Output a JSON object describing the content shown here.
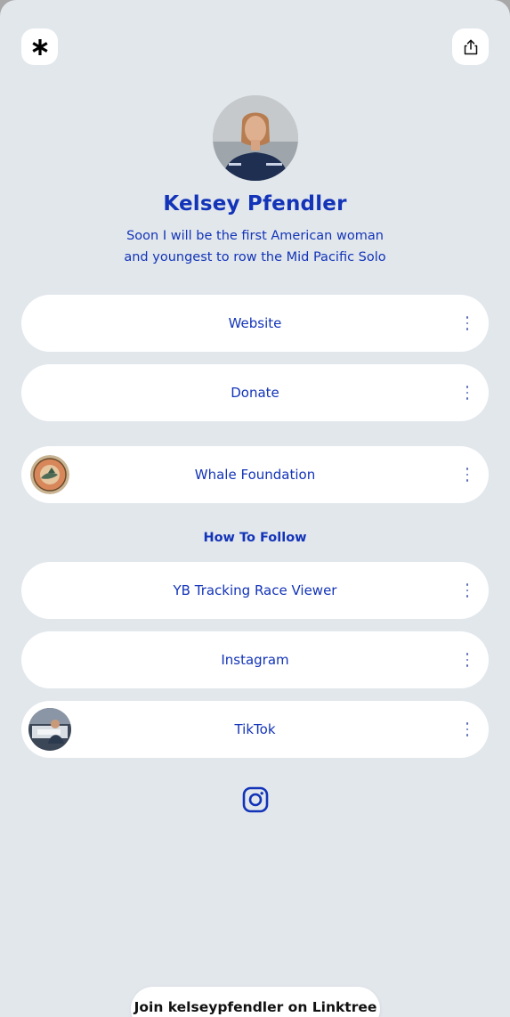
{
  "profile": {
    "name": "Kelsey Pfendler",
    "bio_line1": "Soon I will be the first American woman",
    "bio_line2": "and youngest to row the Mid Pacific Solo"
  },
  "links": [
    {
      "label": "Website"
    },
    {
      "label": "Donate"
    },
    {
      "label": "Whale Foundation",
      "thumbnail": "whale-foundation-logo"
    },
    {
      "label": "YB Tracking Race Viewer"
    },
    {
      "label": "Instagram"
    },
    {
      "label": "TikTok",
      "thumbnail": "tiktok-photo"
    }
  ],
  "section": {
    "heading": "How To Follow"
  },
  "social_icons": [
    "instagram-icon"
  ],
  "footer": {
    "join_label": "Join kelseypfendler on Linktree"
  },
  "colors": {
    "background": "#e2e7ec",
    "accent_text": "#1334b8",
    "card": "#ffffff"
  }
}
